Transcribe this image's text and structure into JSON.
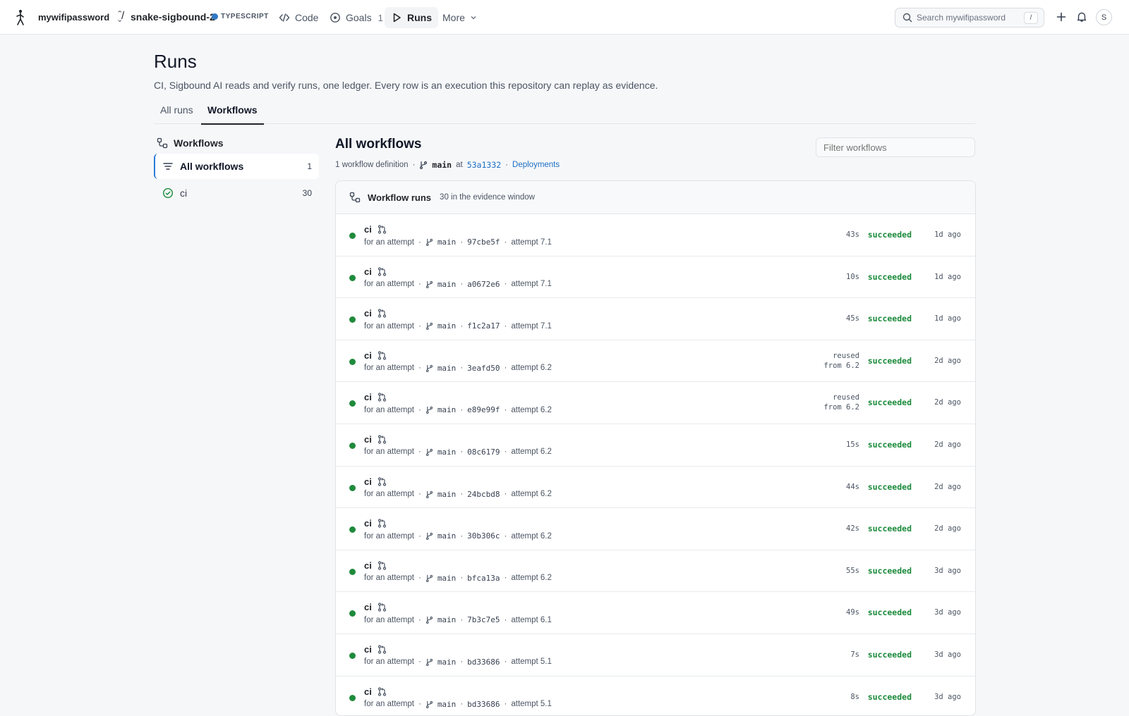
{
  "topbar": {
    "owner": "mywifipassword",
    "repo": "snake-sigbound-2",
    "language": "TYPESCRIPT",
    "language_color": "#3178c6",
    "nav": [
      {
        "label": "Code",
        "icon": "code-icon",
        "count": ""
      },
      {
        "label": "Goals",
        "icon": "target-icon",
        "count": "1"
      },
      {
        "label": "Runs",
        "icon": "play-icon",
        "count": "",
        "active": true
      },
      {
        "label": "More",
        "icon": "chevron-down-icon",
        "count": ""
      }
    ],
    "search_placeholder": "Search mywifipassword",
    "search_shortcut": "/",
    "avatar_initial": "S"
  },
  "page": {
    "title": "Runs",
    "description": "CI, Sigbound AI reads and verify runs, one ledger. Every row is an execution this repository can replay as evidence.",
    "tabs": [
      {
        "label": "All runs",
        "active": false
      },
      {
        "label": "Workflows",
        "active": true
      }
    ]
  },
  "sidebar": {
    "heading": "Workflows",
    "items": [
      {
        "label": "All workflows",
        "count": "1",
        "icon": "filter-icon",
        "active": true
      },
      {
        "label": "ci",
        "count": "30",
        "icon": "check-circle-icon",
        "active": false
      }
    ]
  },
  "main": {
    "title": "All workflows",
    "definition_count": "1 workflow definition",
    "branch": "main",
    "at": "at",
    "sha": "53a1332",
    "deployments_link": "Deployments",
    "filter_placeholder": "Filter workflows",
    "panel_title": "Workflow runs",
    "panel_subtitle": "30 in the evidence window"
  },
  "status_color": "#1a8a3a",
  "runs": [
    {
      "name": "ci",
      "trigger": "for an attempt",
      "branch": "main",
      "sha": "97cbe5f",
      "attempt": "attempt 7.1",
      "duration": "43s",
      "reused": "",
      "status": "succeeded",
      "ago": "1d ago"
    },
    {
      "name": "ci",
      "trigger": "for an attempt",
      "branch": "main",
      "sha": "a0672e6",
      "attempt": "attempt 7.1",
      "duration": "10s",
      "reused": "",
      "status": "succeeded",
      "ago": "1d ago"
    },
    {
      "name": "ci",
      "trigger": "for an attempt",
      "branch": "main",
      "sha": "f1c2a17",
      "attempt": "attempt 7.1",
      "duration": "45s",
      "reused": "",
      "status": "succeeded",
      "ago": "1d ago"
    },
    {
      "name": "ci",
      "trigger": "for an attempt",
      "branch": "main",
      "sha": "3eafd50",
      "attempt": "attempt 6.2",
      "duration": "",
      "reused": [
        "reused",
        "from 6.2"
      ],
      "status": "succeeded",
      "ago": "2d ago"
    },
    {
      "name": "ci",
      "trigger": "for an attempt",
      "branch": "main",
      "sha": "e89e99f",
      "attempt": "attempt 6.2",
      "duration": "",
      "reused": [
        "reused",
        "from 6.2"
      ],
      "status": "succeeded",
      "ago": "2d ago"
    },
    {
      "name": "ci",
      "trigger": "for an attempt",
      "branch": "main",
      "sha": "08c6179",
      "attempt": "attempt 6.2",
      "duration": "15s",
      "reused": "",
      "status": "succeeded",
      "ago": "2d ago"
    },
    {
      "name": "ci",
      "trigger": "for an attempt",
      "branch": "main",
      "sha": "24bcbd8",
      "attempt": "attempt 6.2",
      "duration": "44s",
      "reused": "",
      "status": "succeeded",
      "ago": "2d ago"
    },
    {
      "name": "ci",
      "trigger": "for an attempt",
      "branch": "main",
      "sha": "30b306c",
      "attempt": "attempt 6.2",
      "duration": "42s",
      "reused": "",
      "status": "succeeded",
      "ago": "2d ago"
    },
    {
      "name": "ci",
      "trigger": "for an attempt",
      "branch": "main",
      "sha": "bfca13a",
      "attempt": "attempt 6.2",
      "duration": "55s",
      "reused": "",
      "status": "succeeded",
      "ago": "3d ago"
    },
    {
      "name": "ci",
      "trigger": "for an attempt",
      "branch": "main",
      "sha": "7b3c7e5",
      "attempt": "attempt 6.1",
      "duration": "49s",
      "reused": "",
      "status": "succeeded",
      "ago": "3d ago"
    },
    {
      "name": "ci",
      "trigger": "for an attempt",
      "branch": "main",
      "sha": "bd33686",
      "attempt": "attempt 5.1",
      "duration": "7s",
      "reused": "",
      "status": "succeeded",
      "ago": "3d ago"
    },
    {
      "name": "ci",
      "trigger": "for an attempt",
      "branch": "main",
      "sha": "bd33686",
      "attempt": "attempt 5.1",
      "duration": "8s",
      "reused": "",
      "status": "succeeded",
      "ago": "3d ago"
    }
  ]
}
